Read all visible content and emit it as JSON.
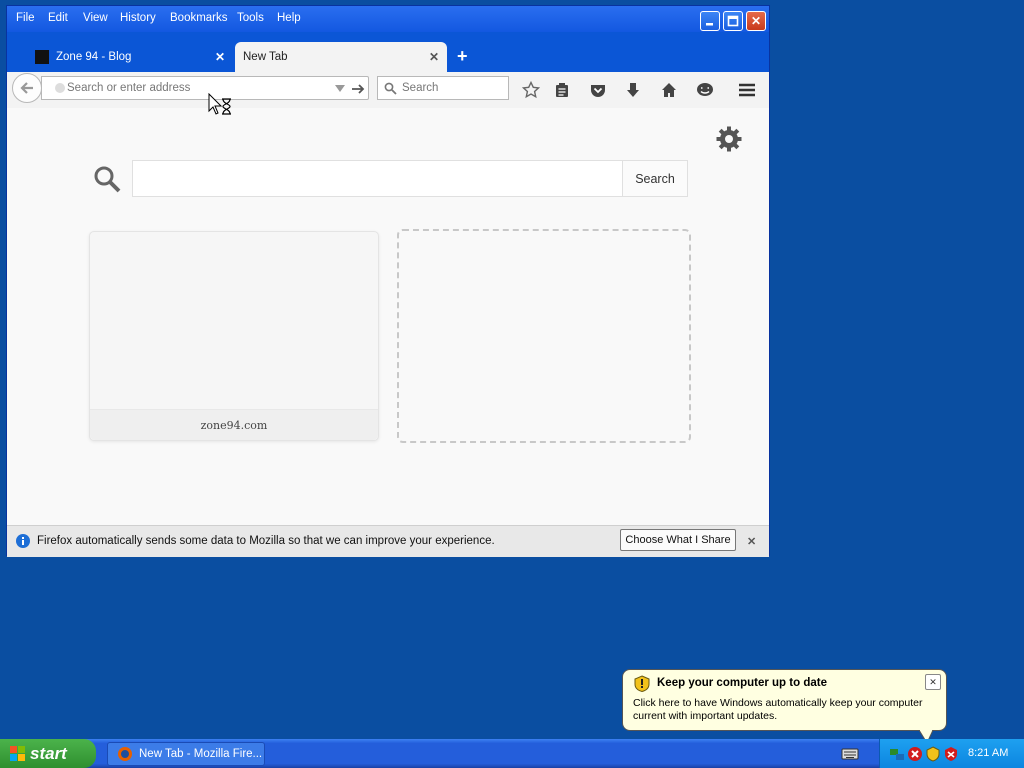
{
  "window": {
    "menu": [
      "File",
      "Edit",
      "View",
      "History",
      "Bookmarks",
      "Tools",
      "Help"
    ],
    "minimize_glyph": "_",
    "close_glyph": "✕"
  },
  "tabs": [
    {
      "label": "Zone 94 - Blog",
      "close": "✕"
    },
    {
      "label": "New Tab",
      "close": "✕"
    }
  ],
  "new_tab_glyph": "+",
  "navbar": {
    "url_placeholder": "Search or enter address",
    "search_placeholder": "Search"
  },
  "newtab": {
    "search_button": "Search",
    "tiles": [
      {
        "label": "zone94.com"
      }
    ]
  },
  "notification": {
    "message": "Firefox automatically sends some data to Mozilla so that we can improve your experience.",
    "button": "Choose What I Share",
    "close": "✕"
  },
  "taskbar": {
    "start_label": "start",
    "task_label": "New Tab - Mozilla Fire...",
    "clock": "8:21 AM"
  },
  "balloon": {
    "title": "Keep your computer up to date",
    "body": "Click here to have Windows automatically keep your computer current with important updates.",
    "close": "✕"
  },
  "colors": {
    "desktop": "#0a4ea1",
    "titlebar": "#0b56d6",
    "taskbar": "#245edb",
    "start": "#2f8f2f",
    "tray": "#0c86e0"
  }
}
